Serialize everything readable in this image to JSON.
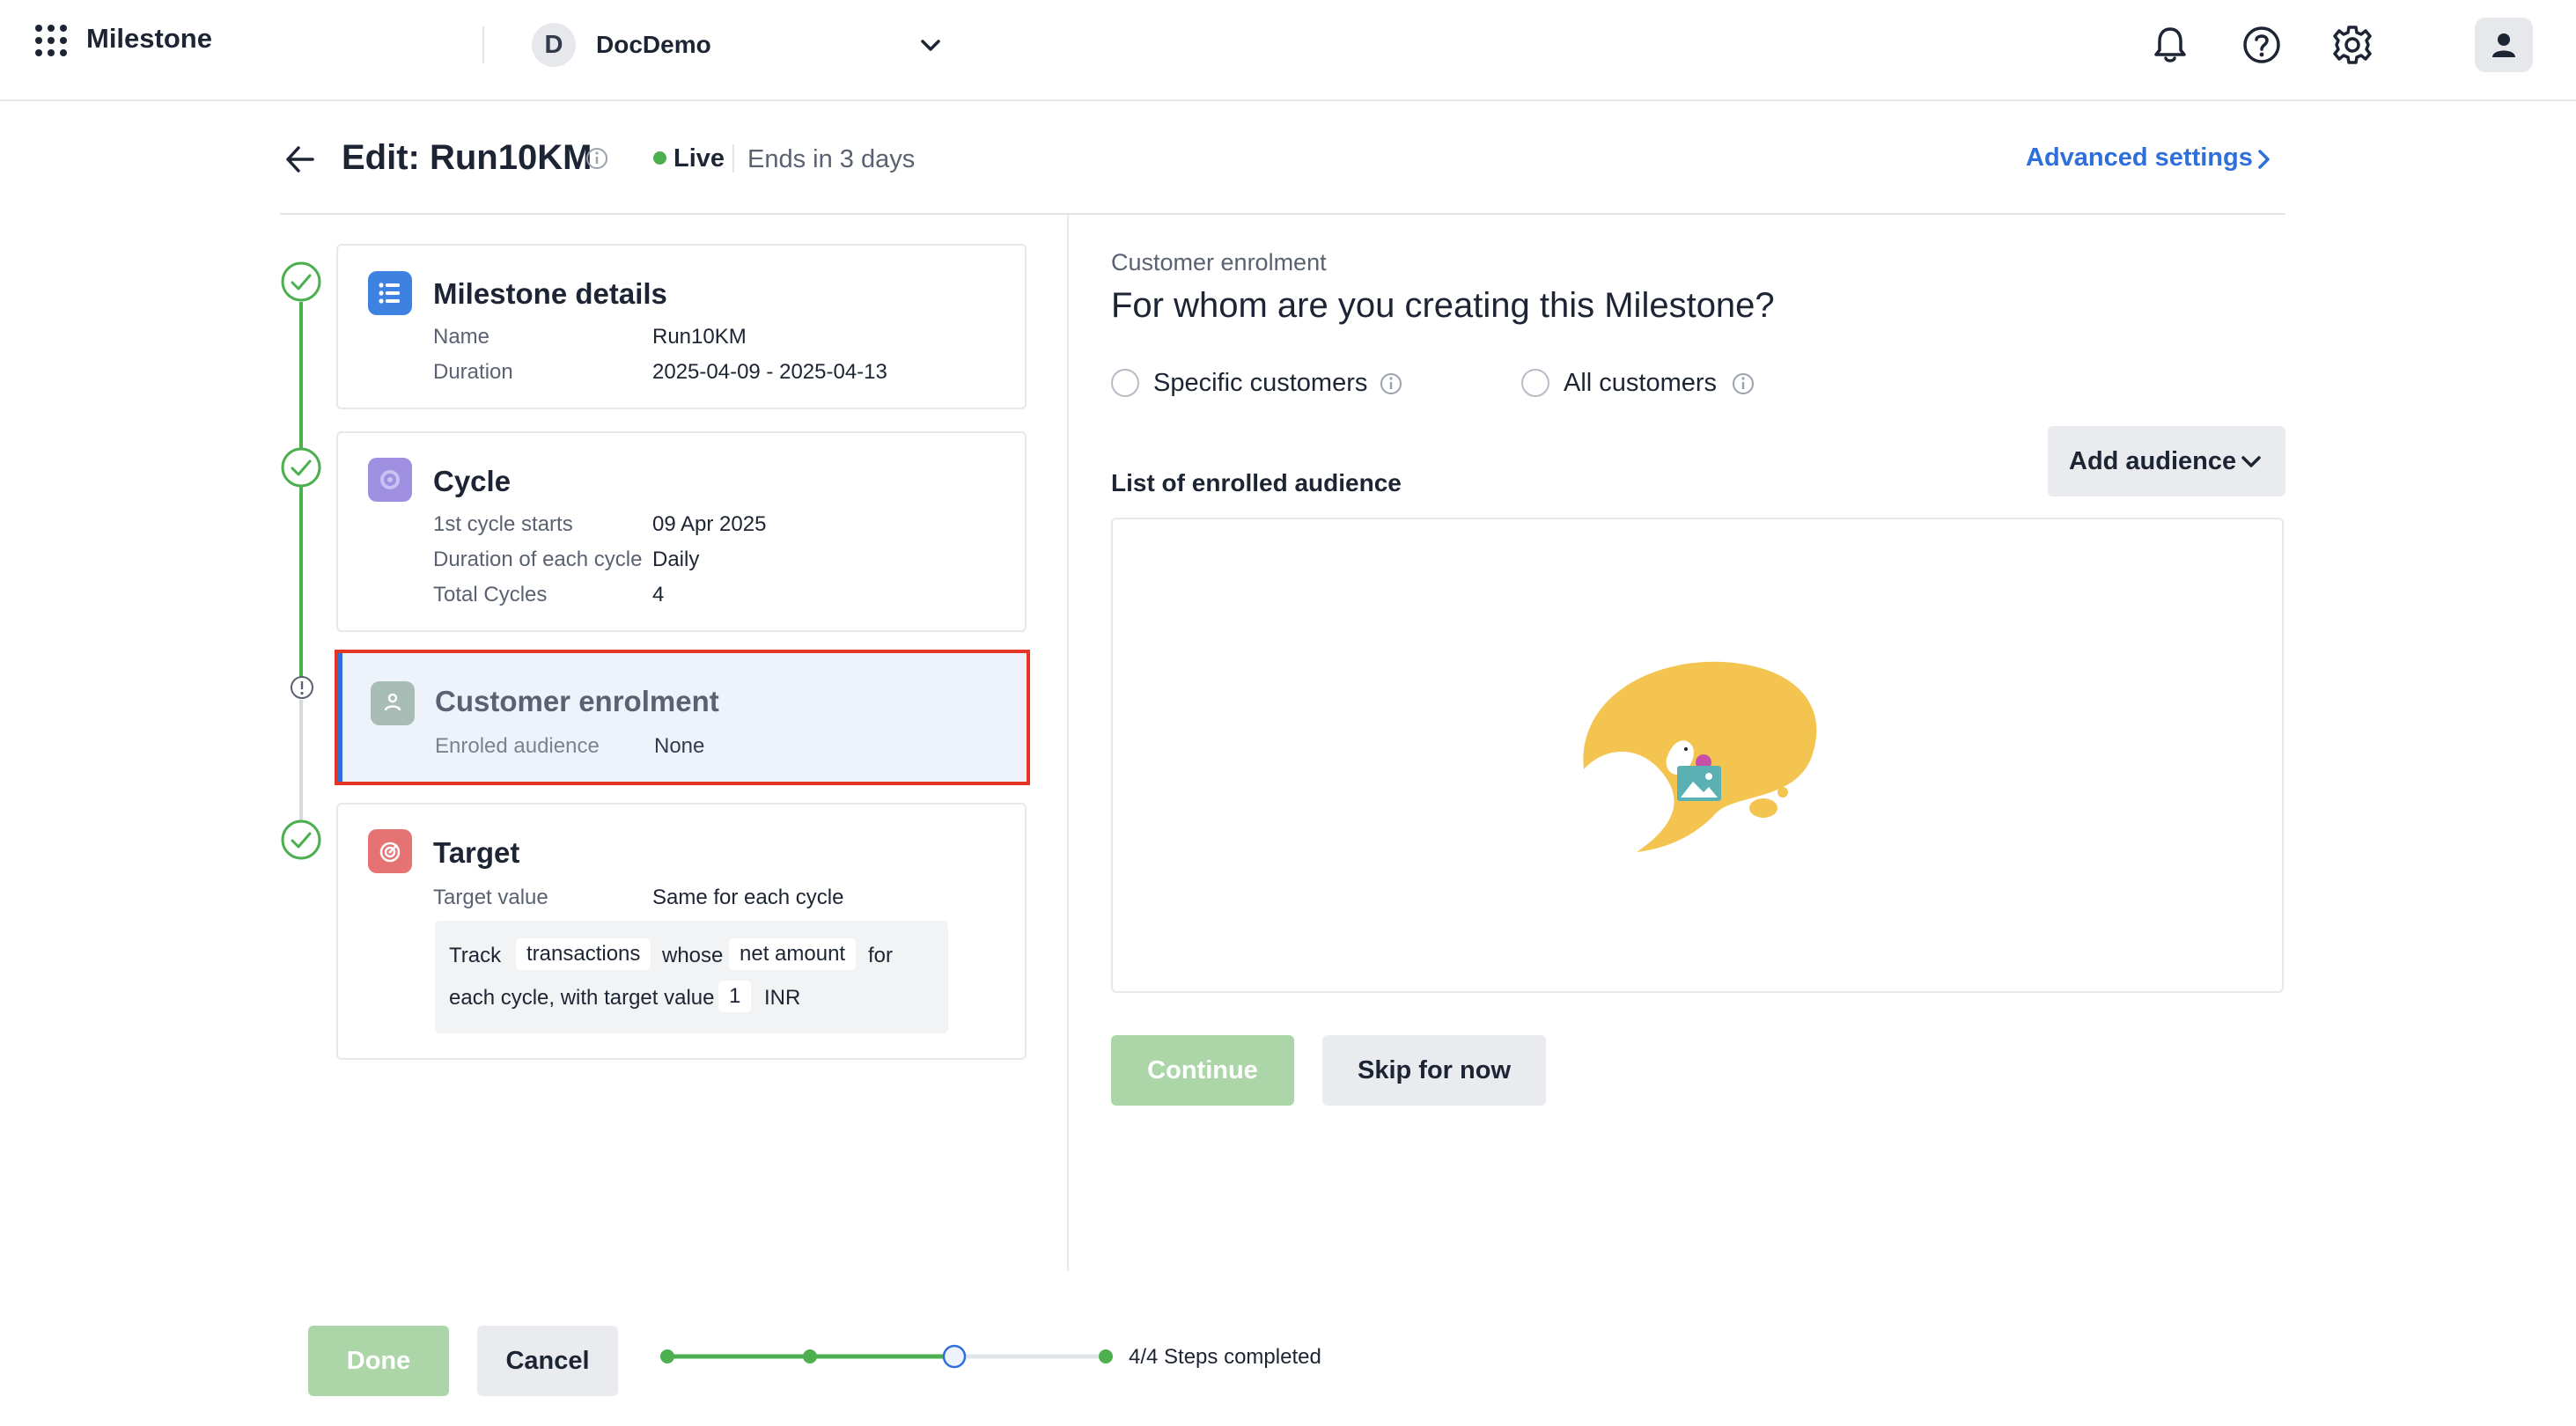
{
  "topbar": {
    "app_name": "Milestone",
    "org_initial": "D",
    "org_name": "DocDemo"
  },
  "header": {
    "title": "Edit: Run10KM",
    "status": "Live",
    "ends": "Ends in 3 days",
    "advanced_settings": "Advanced settings"
  },
  "steps": {
    "details": {
      "title": "Milestone details",
      "rows": [
        {
          "label": "Name",
          "value": "Run10KM"
        },
        {
          "label": "Duration",
          "value": "2025-04-09 - 2025-04-13"
        }
      ]
    },
    "cycle": {
      "title": "Cycle",
      "rows": [
        {
          "label": "1st cycle starts",
          "value": "09 Apr 2025"
        },
        {
          "label": "Duration of each cycle",
          "value": "Daily"
        },
        {
          "label": "Total Cycles",
          "value": "4"
        }
      ]
    },
    "enrolment": {
      "title": "Customer enrolment",
      "rows": [
        {
          "label": "Enroled audience",
          "value": "None"
        }
      ]
    },
    "target": {
      "title": "Target",
      "rows": [
        {
          "label": "Target value",
          "value": "Same for each cycle"
        }
      ],
      "summary": {
        "track": "Track",
        "chip1": "transactions",
        "whose": "whose",
        "chip2": "net amount",
        "for": "for",
        "line2": "each cycle, with target value",
        "chip3": "1",
        "unit": "INR"
      }
    }
  },
  "enrolment_panel": {
    "section_label": "Customer enrolment",
    "question": "For whom are you creating this Milestone?",
    "options": [
      "Specific customers",
      "All customers"
    ],
    "list_title": "List of enrolled audience",
    "add_audience": "Add audience",
    "continue": "Continue",
    "skip": "Skip for now"
  },
  "footer": {
    "done": "Done",
    "cancel": "Cancel",
    "progress_text": "4/4 Steps completed"
  },
  "colors": {
    "accent": "#2e6fdc",
    "success": "#4caf50",
    "error_outline": "#e53525",
    "disabled_green": "#acd6a8"
  }
}
